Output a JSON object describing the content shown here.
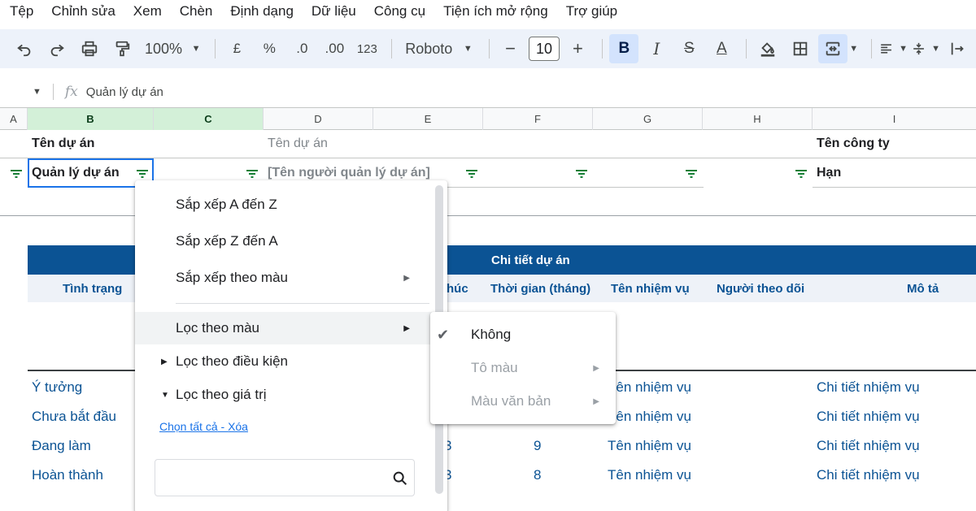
{
  "menu": [
    "Tệp",
    "Chỉnh sửa",
    "Xem",
    "Chèn",
    "Định dạng",
    "Dữ liệu",
    "Công cụ",
    "Tiện ích mở rộng",
    "Trợ giúp"
  ],
  "toolbar": {
    "zoom": "100%",
    "currency": "£",
    "percent": "%",
    "decrease_decimal": ".0",
    "increase_decimal": ".00",
    "number_format": "123",
    "font": "Roboto",
    "minus": "−",
    "font_size": "10",
    "plus": "+",
    "bold": "B",
    "italic": "I",
    "strike": "S",
    "text_color": "A"
  },
  "formula_bar": {
    "fx": "fx",
    "content": "Quản lý dự án"
  },
  "columns": [
    "A",
    "B",
    "C",
    "D",
    "E",
    "F",
    "G",
    "H",
    "I"
  ],
  "sheet": {
    "label_project_name": "Tên dự án",
    "placeholder_project_name": "Tên dự án",
    "label_company": "Tên công ty",
    "cell_project": "Quản lý dự án",
    "cell_manager": "[Tên người quản lý dự án]",
    "cell_deadline": "Hạn",
    "table_title": "Chi tiết dự án",
    "headers": {
      "status": "Tình trạng",
      "end_partial": "húc",
      "duration": "Thời gian (tháng)",
      "task_name": "Tên nhiệm vụ",
      "follower": "Người theo dõi",
      "description": "Mô tả"
    },
    "rows": [
      {
        "status": "Ý tưởng",
        "partial": "",
        "duration": "",
        "task": "Tên nhiệm vụ",
        "desc": "Chi tiết nhiệm vụ"
      },
      {
        "status": "Chưa bắt đầu",
        "partial": "",
        "duration": "",
        "task": "Tên nhiệm vụ",
        "desc": "Chi tiết nhiệm vụ"
      },
      {
        "status": "Đang làm",
        "partial": "3",
        "duration": "9",
        "task": "Tên nhiệm vụ",
        "desc": "Chi tiết nhiệm vụ"
      },
      {
        "status": "Hoàn thành",
        "partial": "3",
        "duration": "8",
        "task": "Tên nhiệm vụ",
        "desc": "Chi tiết nhiệm vụ"
      }
    ]
  },
  "filter_menu": {
    "sort_az": "Sắp xếp A đến Z",
    "sort_za": "Sắp xếp Z đến A",
    "sort_color": "Sắp xếp theo màu",
    "filter_color": "Lọc theo màu",
    "filter_condition": "Lọc theo điều kiện",
    "filter_value": "Lọc theo giá trị",
    "select_all": "Chọn tất cả",
    "link_sep": " - ",
    "clear": "Xóa"
  },
  "color_submenu": {
    "none": "Không",
    "fill_color": "Tô màu",
    "text_color": "Màu văn bản"
  }
}
